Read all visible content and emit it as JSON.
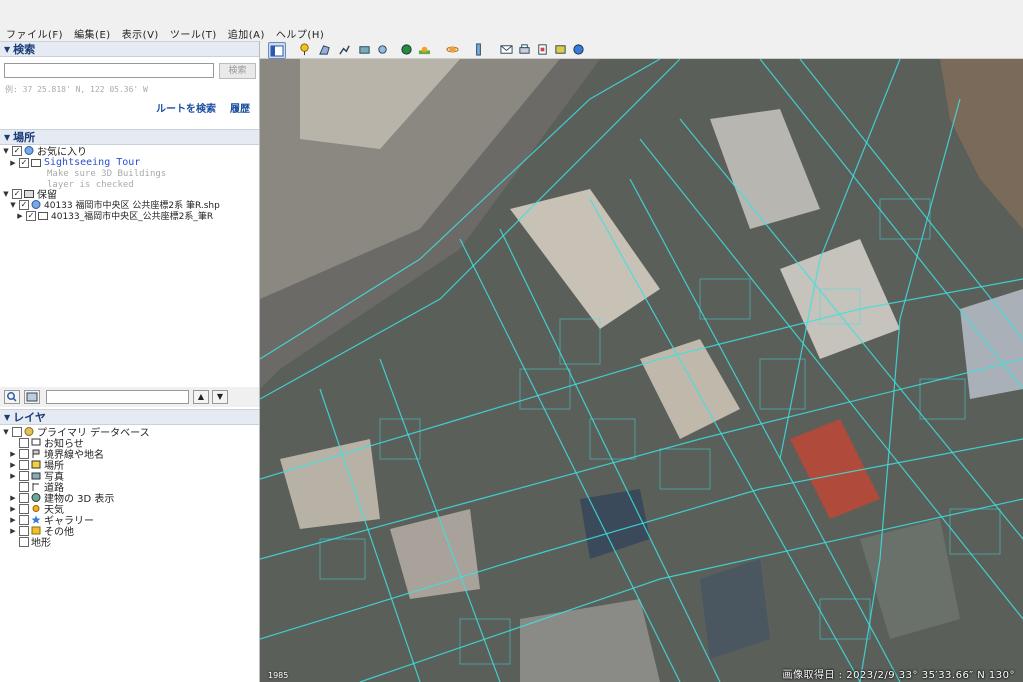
{
  "menu": [
    "ファイル(F)",
    "編集(E)",
    "表示(V)",
    "ツール(T)",
    "追加(A)",
    "ヘルプ(H)"
  ],
  "search": {
    "header": "検索",
    "placeholder": "",
    "button": "検索",
    "example": "例: 37 25.818' N, 122 05.36' W",
    "route_link": "ルートを検索",
    "history_link": "履歴"
  },
  "places": {
    "header": "場所",
    "favorites": "お気に入り",
    "tour": "Sightseeing Tour",
    "tour_note1": "Make sure 3D Buildings",
    "tour_note2": "layer is checked",
    "saved": "保留",
    "shp": "40133 福岡市中央区 公共座標2系 筆R.shp",
    "folder": "40133_福岡市中央区_公共座標2系_筆R"
  },
  "layers": {
    "header": "レイヤ",
    "primary": "プライマリ データベース",
    "items": [
      "お知らせ",
      "境界線や地名",
      "場所",
      "写真",
      "道路",
      "建物の 3D 表示",
      "天気",
      "ギャラリー",
      "その他",
      "地形"
    ]
  },
  "map": {
    "status": "画像取得日 : 2023/2/9   33° 35′33.66″ N 130°",
    "scale_label": "1985"
  },
  "colors": {
    "accent": "#1a3c78",
    "parcel_line": "#3de0e0",
    "link": "#1a4ea0"
  }
}
